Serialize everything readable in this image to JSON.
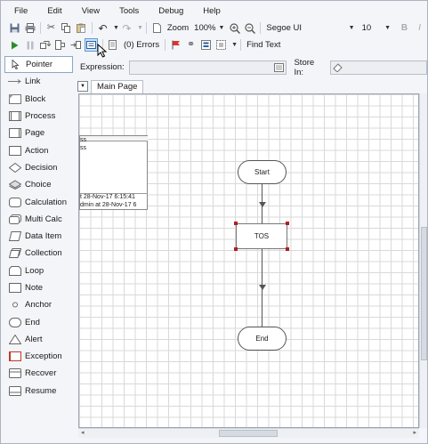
{
  "menu": [
    "File",
    "Edit",
    "View",
    "Tools",
    "Debug",
    "Help"
  ],
  "toolbar": {
    "zoom_label": "Zoom",
    "zoom_value": "100%",
    "font_name": "Segoe UI",
    "font_size": "10",
    "errors": "(0) Errors",
    "find_text": "Find Text"
  },
  "palette": [
    {
      "label": "Pointer",
      "icon": "pointer-icon"
    },
    {
      "label": "Link",
      "icon": "link-icon"
    },
    {
      "label": "Block",
      "icon": "block-icon"
    },
    {
      "label": "Process",
      "icon": "process-icon"
    },
    {
      "label": "Page",
      "icon": "page-icon"
    },
    {
      "label": "Action",
      "icon": "action-icon"
    },
    {
      "label": "Decision",
      "icon": "decision-icon"
    },
    {
      "label": "Choice",
      "icon": "choice-icon"
    },
    {
      "label": "Calculation",
      "icon": "calculation-icon"
    },
    {
      "label": "Multi Calc",
      "icon": "multi-calc-icon"
    },
    {
      "label": "Data Item",
      "icon": "data-item-icon"
    },
    {
      "label": "Collection",
      "icon": "collection-icon"
    },
    {
      "label": "Loop",
      "icon": "loop-icon"
    },
    {
      "label": "Note",
      "icon": "note-icon"
    },
    {
      "label": "Anchor",
      "icon": "anchor-icon"
    },
    {
      "label": "End",
      "icon": "end-icon"
    },
    {
      "label": "Alert",
      "icon": "alert-icon"
    },
    {
      "label": "Exception",
      "icon": "exception-icon"
    },
    {
      "label": "Recover",
      "icon": "recover-icon"
    },
    {
      "label": "Resume",
      "icon": "resume-icon"
    }
  ],
  "expression_label": "Expression:",
  "store_in_label": "Store In:",
  "tab": "Main Page",
  "note_lines": [
    "ss",
    "ss",
    "t 28-Nov-17 6:15:41",
    "dmin at 28-Nov-17 6"
  ],
  "flow": {
    "start": "Start",
    "stage": "TOS",
    "end": "End"
  },
  "colors": {
    "selection_handle": "#b11e1e",
    "grid": "#d9d9d9",
    "pressed_button": "#cfe3f7"
  }
}
